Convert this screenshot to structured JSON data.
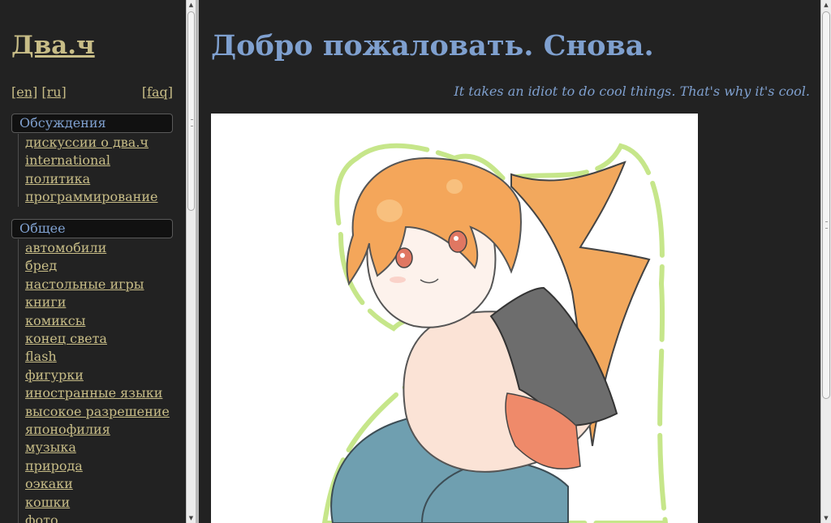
{
  "sidebar": {
    "logo": "Два.ч",
    "lang_en": "[en]",
    "lang_ru": "[ru]",
    "faq": "[faq]",
    "sections": [
      {
        "title": "Обсуждения",
        "items": [
          "дискуссии о два.ч",
          "international",
          "политика",
          "программирование"
        ]
      },
      {
        "title": "Общее",
        "items": [
          "автомобили",
          "бред",
          "настольные игры",
          "книги",
          "комиксы",
          "конец света",
          "flash",
          "фигурки",
          "иностранные языки",
          "высокое разрешение",
          "японофилия",
          "музыка",
          "природа",
          "оэкаки",
          "кошки",
          "фото"
        ]
      }
    ]
  },
  "main": {
    "title": "Добро пожаловать. Снова.",
    "tagline": "It takes an idiot to do cool things. That's why it's cool."
  },
  "colors": {
    "background": "#222222",
    "link": "#c8bd87",
    "accent_blue": "#7fa0cf"
  }
}
